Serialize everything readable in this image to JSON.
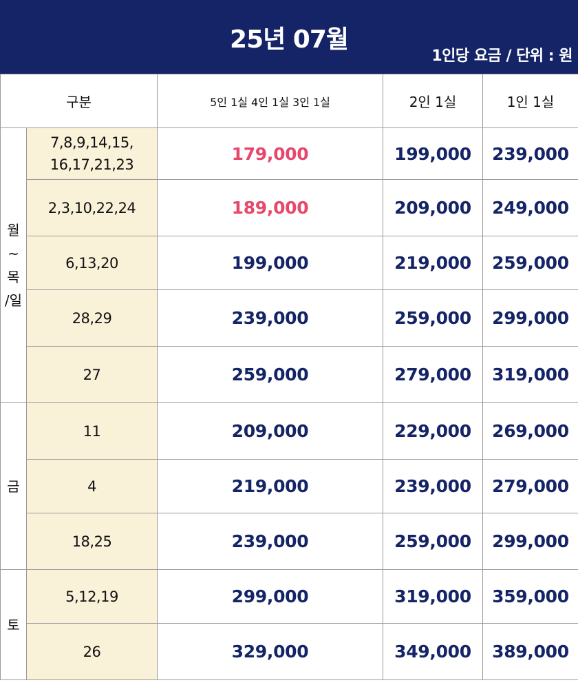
{
  "header": {
    "title": "25년 07월",
    "unit_note": "1인당 요금 / 단위 : 원",
    "background_color": "#142466"
  },
  "columns": {
    "category": "구분",
    "col1": "5인 1실 4인 1실 3인 1실",
    "col2": "2인 1실",
    "col3": "1인 1실"
  },
  "groups": [
    {
      "label": "월\n~\n목\n/일"
    },
    {
      "label": "금"
    },
    {
      "label": "토"
    }
  ],
  "rows": [
    {
      "days": "7,8,9,14,15,\n16,17,21,23",
      "p1": "179,000",
      "p2": "199,000",
      "p3": "239,000"
    },
    {
      "days": "2,3,10,22,24",
      "p1": "189,000",
      "p2": "209,000",
      "p3": "249,000"
    },
    {
      "days": "6,13,20",
      "p1": "199,000",
      "p2": "219,000",
      "p3": "259,000"
    },
    {
      "days": "28,29",
      "p1": "239,000",
      "p2": "259,000",
      "p3": "299,000"
    },
    {
      "days": "27",
      "p1": "259,000",
      "p2": "279,000",
      "p3": "319,000"
    },
    {
      "days": "11",
      "p1": "209,000",
      "p2": "229,000",
      "p3": "269,000"
    },
    {
      "days": "4",
      "p1": "219,000",
      "p2": "239,000",
      "p3": "279,000"
    },
    {
      "days": "18,25",
      "p1": "239,000",
      "p2": "259,000",
      "p3": "299,000"
    },
    {
      "days": "5,12,19",
      "p1": "299,000",
      "p2": "319,000",
      "p3": "359,000"
    },
    {
      "days": "26",
      "p1": "329,000",
      "p2": "349,000",
      "p3": "389,000"
    }
  ],
  "colors": {
    "price_default": "#142466",
    "price_highlight": "#e8476c",
    "days_background": "#faf1d9"
  }
}
